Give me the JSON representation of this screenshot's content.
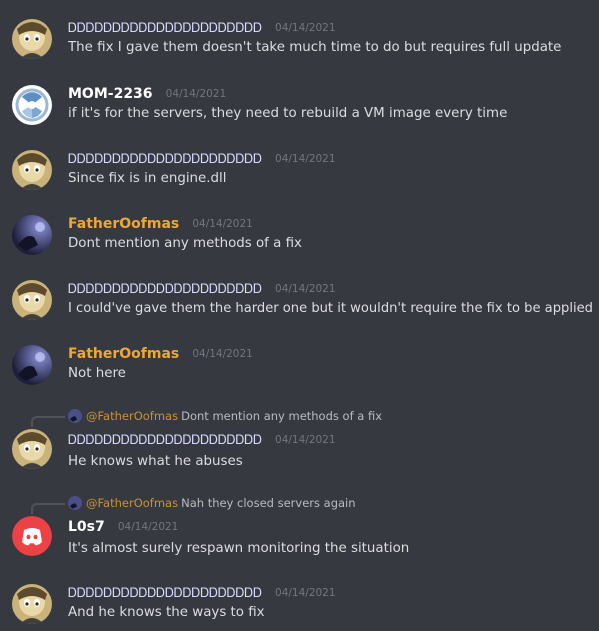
{
  "messages": [
    {
      "author": "ᎠᎠᎠᎠᎠᎠᎠᎠᎠᎠᎠᎠᎠᎠᎠᎠᎠᎠᎠᎠᎠᎠ",
      "timestamp": "04/14/2021",
      "text": "The fix I gave them doesn't take much time to do but requires full update"
    },
    {
      "author": "MOM-2236",
      "timestamp": "04/14/2021",
      "text": "if it's for the servers, they need to rebuild a VM image every time"
    },
    {
      "author": "ᎠᎠᎠᎠᎠᎠᎠᎠᎠᎠᎠᎠᎠᎠᎠᎠᎠᎠᎠᎠᎠᎠ",
      "timestamp": "04/14/2021",
      "text": "Since fix is in engine.dll"
    },
    {
      "author": "FatherOofmas",
      "timestamp": "04/14/2021",
      "text": "Dont mention any methods of a fix"
    },
    {
      "author": "ᎠᎠᎠᎠᎠᎠᎠᎠᎠᎠᎠᎠᎠᎠᎠᎠᎠᎠᎠᎠᎠᎠ",
      "timestamp": "04/14/2021",
      "text": "I could've gave them the harder one but it wouldn't require the fix to be applied"
    },
    {
      "author": "FatherOofmas",
      "timestamp": "04/14/2021",
      "text": "Not here"
    },
    {
      "author": "ᎠᎠᎠᎠᎠᎠᎠᎠᎠᎠᎠᎠᎠᎠᎠᎠᎠᎠᎠᎠᎠᎠ",
      "timestamp": "04/14/2021",
      "text": "He knows what he abuses",
      "reply_to": "@FatherOofmas",
      "reply_text": "Dont mention any methods of a fix"
    },
    {
      "author": "L0s7",
      "timestamp": "04/14/2021",
      "text": "It's almost surely respawn monitoring the situation",
      "reply_to": "@FatherOofmas",
      "reply_text": "Nah they closed servers again"
    },
    {
      "author": "ᎠᎠᎠᎠᎠᎠᎠᎠᎠᎠᎠᎠᎠᎠᎠᎠᎠᎠᎠᎠᎠᎠ",
      "timestamp": "04/14/2021",
      "text": "And he knows the ways to fix"
    }
  ],
  "avatars": {
    "tan": "cartoon-character-avatar",
    "mom": "blue-logo-avatar",
    "father": "night-scene-avatar",
    "discord": "discord-logo-avatar"
  },
  "colors": {
    "background": "#36393f",
    "username_default": "#ffffff",
    "username_orange": "#f0a732",
    "username_glyph": "#d7dbff",
    "text": "#dcddde",
    "timestamp": "#72767d",
    "discord_red": "#ed4245"
  }
}
